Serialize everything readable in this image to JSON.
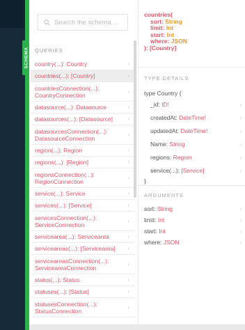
{
  "sidebar": {
    "tab_label": "SCHEMA"
  },
  "search": {
    "placeholder": "Search the schema ..."
  },
  "queries": {
    "label": "QUERIES",
    "items": [
      {
        "name": "country(...)",
        "type": "Country",
        "wrap": false,
        "active": false
      },
      {
        "name": "countries(...)",
        "type": "[Country]",
        "wrap": false,
        "active": true
      },
      {
        "name": "countriesConnection(...)",
        "type": "CountryConnection",
        "wrap": true,
        "active": false
      },
      {
        "name": "datasource(...)",
        "type": "Datasource",
        "wrap": false,
        "active": false
      },
      {
        "name": "datasources(...)",
        "type": "[Datasource]",
        "wrap": false,
        "active": false
      },
      {
        "name": "datasourcesConnection(...)",
        "type": "DatasourceConnection",
        "wrap": true,
        "active": false
      },
      {
        "name": "region(...)",
        "type": "Region",
        "wrap": false,
        "active": false
      },
      {
        "name": "regions(...)",
        "type": "[Region]",
        "wrap": false,
        "active": false
      },
      {
        "name": "regionsConnection(...)",
        "type": "RegionConnection",
        "wrap": true,
        "active": false
      },
      {
        "name": "service(...)",
        "type": "Service",
        "wrap": false,
        "active": false
      },
      {
        "name": "services(...)",
        "type": "[Service]",
        "wrap": false,
        "active": false
      },
      {
        "name": "servicesConnection(...)",
        "type": "ServiceConnection",
        "wrap": true,
        "active": false
      },
      {
        "name": "servicearea(...)",
        "type": "Servicearea",
        "wrap": false,
        "active": false
      },
      {
        "name": "serviceareas(...)",
        "type": "[Servicearea]",
        "wrap": false,
        "active": false
      },
      {
        "name": "serviceareasConnection(...)",
        "type": "ServiceareaConnection",
        "wrap": true,
        "active": false
      },
      {
        "name": "status(...)",
        "type": "Status",
        "wrap": false,
        "active": false
      },
      {
        "name": "statuses(...)",
        "type": "[Status]",
        "wrap": false,
        "active": false
      },
      {
        "name": "statusesConnection(...)",
        "type": "StatusConnection",
        "wrap": true,
        "active": false
      }
    ]
  },
  "detail": {
    "signature": {
      "name": "countries(",
      "args": [
        {
          "k": "sort",
          "t": "String"
        },
        {
          "k": "limit",
          "t": "Int"
        },
        {
          "k": "start",
          "t": "Int"
        },
        {
          "k": "where",
          "t": "JSON"
        }
      ],
      "close": "):",
      "return_type": "[Country]"
    },
    "type_details_label": "TYPE DETAILS",
    "type_keyword": "type",
    "type_name": "Country",
    "open_brace": "{",
    "close_brace": "}",
    "fields": [
      {
        "name": "_id",
        "type": "ID!"
      },
      {
        "name": "createdAt",
        "type": "DateTime!"
      },
      {
        "name": "updatedAt",
        "type": "DateTime!"
      },
      {
        "name": "Name",
        "type": "String"
      },
      {
        "name": "regions",
        "type": "Region"
      },
      {
        "name": "service(...)",
        "type": "[Service]"
      }
    ],
    "arguments_label": "ARGUMENTS",
    "arguments": [
      {
        "name": "sort",
        "type": "String"
      },
      {
        "name": "limit",
        "type": "Int"
      },
      {
        "name": "start",
        "type": "Int"
      },
      {
        "name": "where",
        "type": "JSON"
      }
    ]
  },
  "colors": {
    "accent_green": "#2bb24c",
    "field_pink": "#e6556a",
    "type_orange": "#e79a28",
    "dark_rail": "#172a3a"
  }
}
